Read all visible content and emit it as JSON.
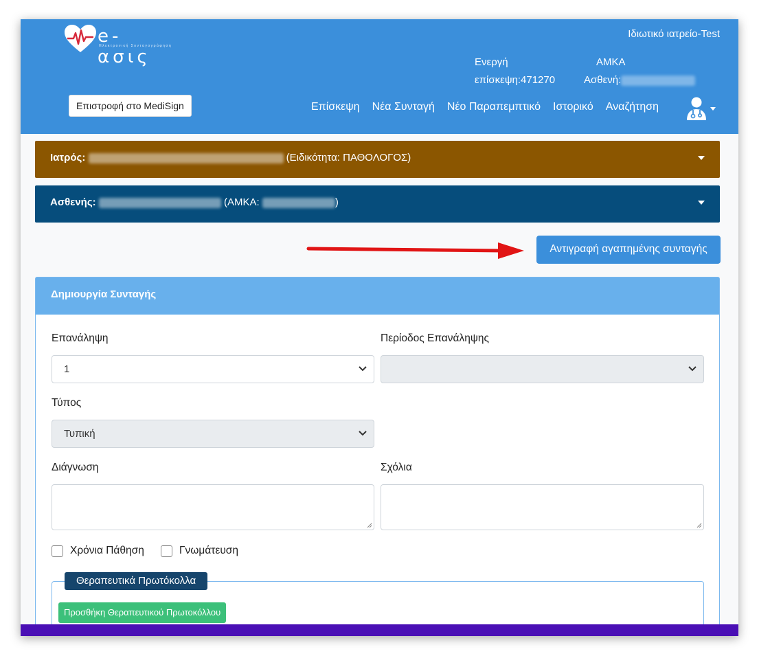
{
  "header": {
    "logo_text": "e-ασις",
    "logo_subtitle": "Ηλεκτρονική Συνταγογράφηση",
    "office": "Ιδιωτικό ιατρείο-Test",
    "visit_label_1": "Ενεργή",
    "visit_label_2": "επίσκεψη:471270",
    "amka_label_1": "ΑΜΚΑ",
    "amka_label_2": "Ασθενή:",
    "back_button": "Επιστροφή στο MediSign",
    "nav": [
      "Επίσκεψη",
      "Νέα Συνταγή",
      "Νέο Παραπεμπτικό",
      "Ιστορικό",
      "Αναζήτηση"
    ],
    "user_icon": "doctor-user-icon"
  },
  "doctor_bar": {
    "label": "Ιατρός:",
    "specialty": "(Ειδικότητα: ΠΑΘΟΛΟΓΟΣ)",
    "color": "#8b5600"
  },
  "patient_bar": {
    "label": "Ασθενής:",
    "amka_prefix": "(ΑΜΚΑ:",
    "amka_suffix": ")",
    "color": "#064d7c"
  },
  "copy_button": "Αντιγραφή αγαπημένης συνταγής",
  "form": {
    "title": "Δημιουργία Συνταγής",
    "repeat_label": "Επανάληψη",
    "repeat_value": "1",
    "period_label": "Περίοδος Επανάληψης",
    "period_value": "",
    "type_label": "Τύπος",
    "type_value": "Τυπική",
    "diagnosis_label": "Διάγνωση",
    "comments_label": "Σχόλια",
    "chronic_label": "Χρόνια Πάθηση",
    "opinion_label": "Γνωμάτευση",
    "protocols_legend": "Θεραπευτικά Πρωτόκολλα",
    "add_protocol_button": "Προσθήκη Θεραπευτικού Πρωτοκόλλου"
  },
  "colors": {
    "header": "#3b8fdb",
    "accent_green": "#3cc07a",
    "footer": "#4a0fb5",
    "arrow": "#e11515"
  }
}
